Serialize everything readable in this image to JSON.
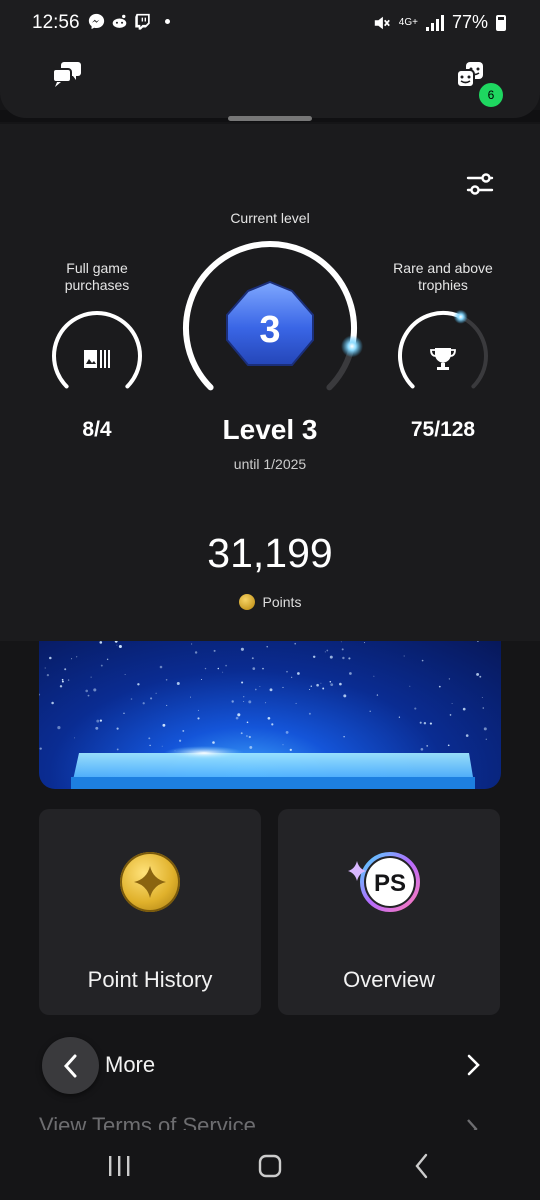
{
  "status_bar": {
    "time": "12:56",
    "network": "4G+",
    "battery": "77%",
    "apps": [
      "messenger-icon",
      "reddit-icon",
      "twitch-icon"
    ]
  },
  "header": {
    "chat_icon": "chat-bubbles-icon",
    "party_icon": "party-faces-icon",
    "party_badge": "6"
  },
  "level": {
    "current_level_label": "Current level",
    "level_number": "3",
    "level_title": "Level 3",
    "until": "until 1/2025",
    "progress": 0.88
  },
  "purchases": {
    "label_line1": "Full game",
    "label_line2": "purchases",
    "value": "8/4",
    "progress": 1.0
  },
  "trophies": {
    "label_line1": "Rare and above",
    "label_line2": "trophies",
    "value": "75/128",
    "progress": 0.59
  },
  "points": {
    "value": "31,199",
    "label": "Points"
  },
  "tiles": [
    {
      "label": "Point History",
      "icon": "gold-coin-icon"
    },
    {
      "label": "Overview",
      "icon": "playstation-stars-icon"
    }
  ],
  "rows": {
    "more_label": "More",
    "terms_label": "View Terms of Service"
  },
  "colors": {
    "accent_glow": "#4fc3ff",
    "badge_green": "#1ed760",
    "coin_gold": "#e0b12b"
  }
}
